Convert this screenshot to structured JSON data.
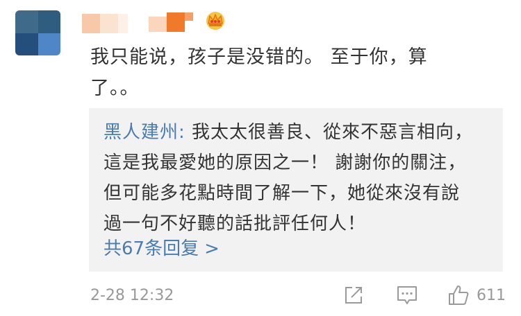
{
  "comment": {
    "text_line1": "我只能说，孩子是没错的。 至于你，算",
    "text_line2": "了。。",
    "timestamp": "2-28 12:32",
    "like_count": "611"
  },
  "reply": {
    "author": "黑人建州:",
    "line1": " 我太太很善良、從來不惡言相向，",
    "line2": "這是我最愛她的原因之一！ 謝謝你的關注，",
    "line3": "但可能多花點時間了解一下，她從來沒有說",
    "line4": "過一句不好聽的話批評任何人！",
    "more_label": "共67条回复",
    "more_chevron": ">"
  },
  "icons": {
    "share": "share-icon",
    "comment": "comment-icon",
    "like": "thumbs-up-icon",
    "badge": "crown-icon"
  },
  "colors": {
    "link_blue": "#4a7cb0",
    "meta_gray": "#999999",
    "reply_bg": "#f2f2f2"
  }
}
